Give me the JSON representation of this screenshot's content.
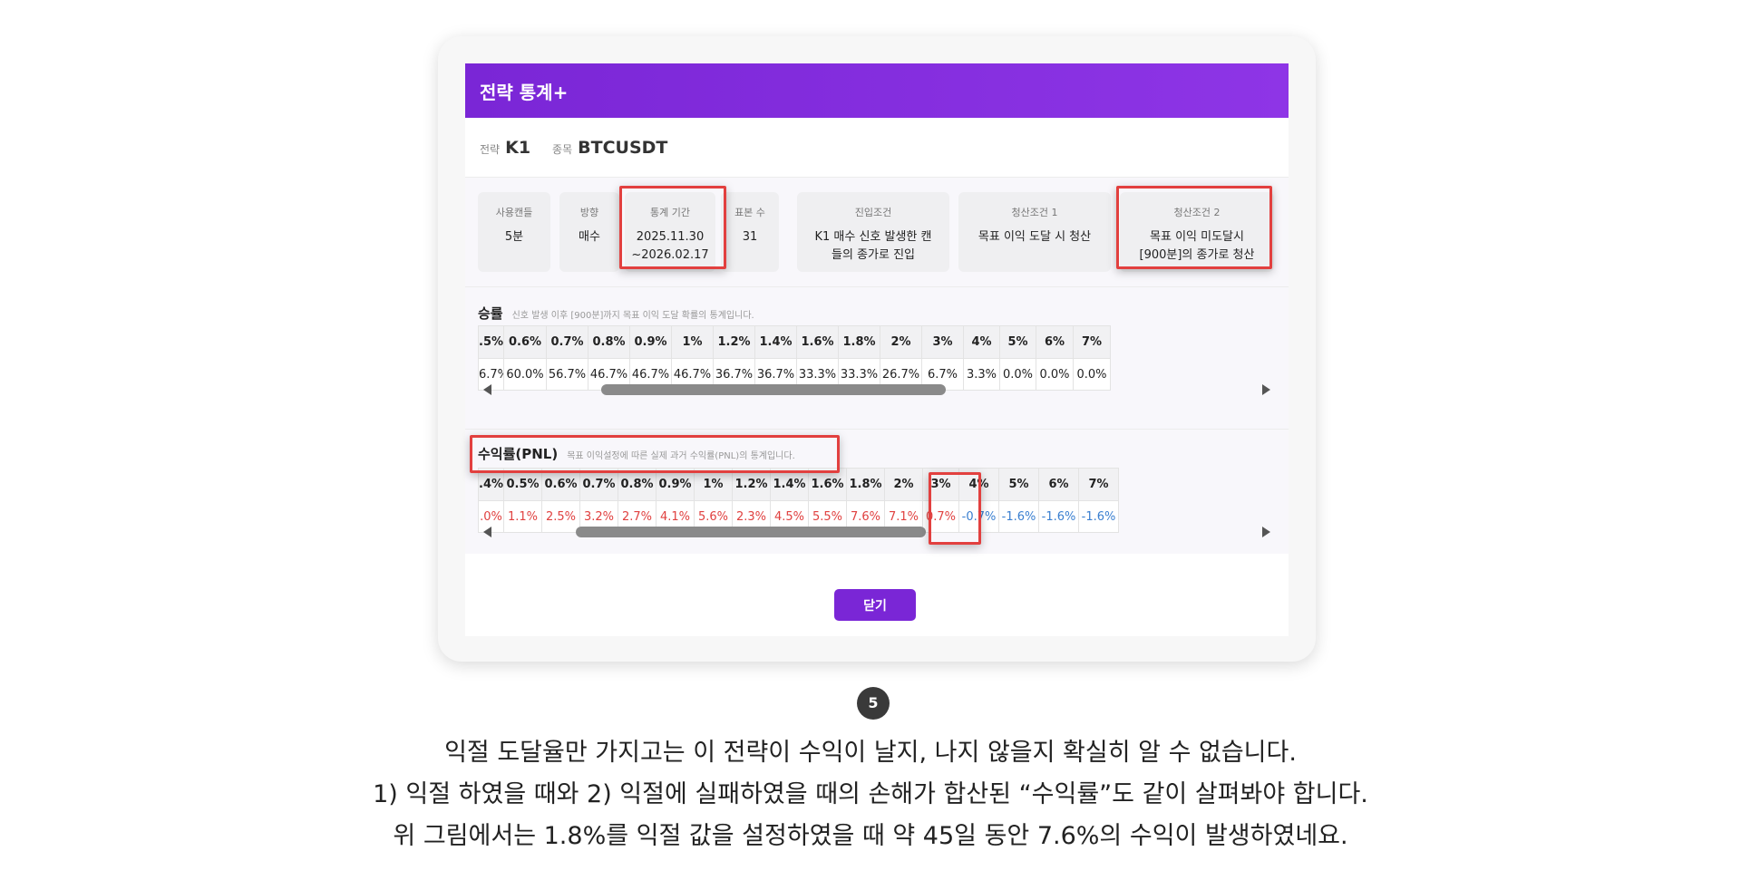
{
  "modal": {
    "title": "전략 통계+",
    "strategy_label": "전략",
    "strategy_value": "K1",
    "symbol_label": "종목",
    "symbol_value": "BTCUSDT",
    "close_label": "닫기"
  },
  "conditions": [
    {
      "label": "사용캔들",
      "value": "5분"
    },
    {
      "label": "방향",
      "value": "매수"
    },
    {
      "label": "통계 기간",
      "value": "2025.11.30\n~2026.02.17"
    },
    {
      "label": "표본 수",
      "value": "31"
    },
    {
      "label": "진입조건",
      "value": "K1 매수 신호 발생한 캔\n들의 종가로 진입"
    },
    {
      "label": "청산조건 1",
      "value": "목표 이익 도달 시 청산"
    },
    {
      "label": "청산조건 2",
      "value": "목표 이익 미도달시\n[900분]의 종가로 청산"
    }
  ],
  "winrate": {
    "title": "승률",
    "description": "신호 발생 이후 [900분]까지 목표 이익 도달 확률의 통계입니다.",
    "headers": [
      ".5%",
      "0.6%",
      "0.7%",
      "0.8%",
      "0.9%",
      "1%",
      "1.2%",
      "1.4%",
      "1.6%",
      "1.8%",
      "2%",
      "3%",
      "4%",
      "5%",
      "6%",
      "7%"
    ],
    "values": [
      "6.7%",
      "60.0%",
      "56.7%",
      "46.7%",
      "46.7%",
      "46.7%",
      "36.7%",
      "36.7%",
      "33.3%",
      "33.3%",
      "26.7%",
      "6.7%",
      "3.3%",
      "0.0%",
      "0.0%",
      "0.0%"
    ]
  },
  "pnl": {
    "title": "수익률(PNL)",
    "description": "목표 이익설정에 따른 실제 과거 수익률(PNL)의 통계입니다.",
    "headers": [
      ".4%",
      "0.5%",
      "0.6%",
      "0.7%",
      "0.8%",
      "0.9%",
      "1%",
      "1.2%",
      "1.4%",
      "1.6%",
      "1.8%",
      "2%",
      "3%",
      "4%",
      "5%",
      "6%",
      "7%"
    ],
    "values": [
      ".0%",
      "1.1%",
      "2.5%",
      "3.2%",
      "2.7%",
      "4.1%",
      "5.6%",
      "2.3%",
      "4.5%",
      "5.5%",
      "7.6%",
      "7.1%",
      "0.7%",
      "-0.7%",
      "-1.6%",
      "-1.6%",
      "-1.6%"
    ],
    "highlight_index": 10
  },
  "colors": {
    "accent": "#7a26d6",
    "positive": "#e0403f",
    "negative": "#3a7fd0",
    "highlight": "#e2403f"
  },
  "step_number": "5",
  "caption": [
    "익절 도달율만 가지고는 이 전략이 수익이 날지, 나지 않을지 확실히 알 수 없습니다.",
    "1) 익절 하였을 때와 2) 익절에 실패하였을 때의 손해가 합산된 “수익률”도 같이 살펴봐야 합니다.",
    "위 그림에서는 1.8%를 익절 값을 설정하였을 때 약 45일 동안 7.6%의 수익이 발생하였네요."
  ]
}
